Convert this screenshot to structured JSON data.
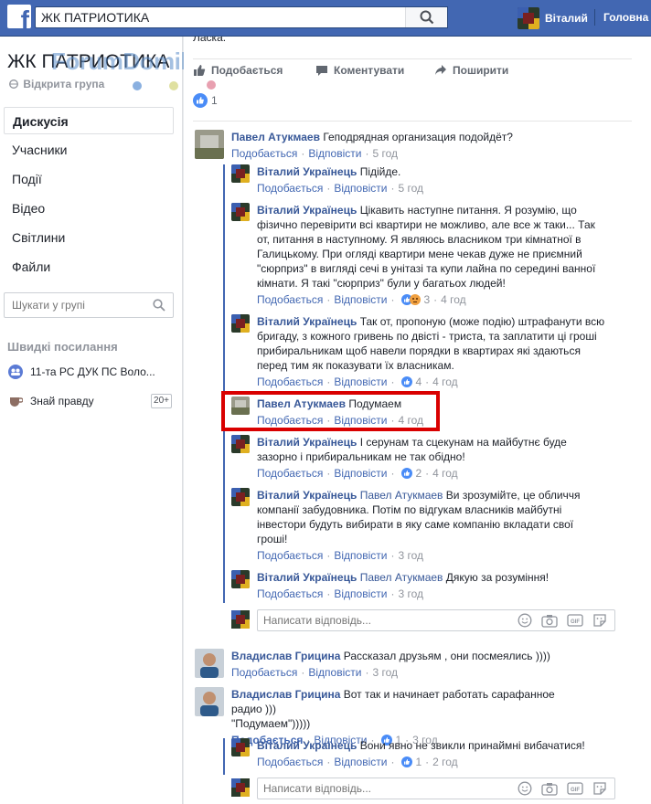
{
  "topbar": {
    "search_value": "ЖК ПАТРИОТИКА",
    "user_name": "Віталий",
    "home": "Головна"
  },
  "left": {
    "group_title": "ЖК ПАТРИОТИКА",
    "watermark": "ForumDomik.ua",
    "privacy": "Відкрита група",
    "nav": [
      "Дискусія",
      "Учасники",
      "Події",
      "Відео",
      "Світлини",
      "Файли"
    ],
    "search_placeholder": "Шукати у групі",
    "quick_title": "Швидкі посилання",
    "quick_links": [
      {
        "label": "11-та РС ДУК ПС Воло...",
        "icon": "group-icon"
      },
      {
        "label": "Знай правду",
        "icon": "cup-icon",
        "badge": "20+"
      }
    ]
  },
  "post": {
    "prev_text": "Ласка.",
    "actions": {
      "like": "Подобається",
      "comment": "Коментувати",
      "share": "Поширити"
    },
    "reaction_count": "1"
  },
  "labels": {
    "like": "Подобається",
    "reply": "Відповісти",
    "reply_placeholder": "Написати відповідь..."
  },
  "comments": [
    {
      "author": "Павел Атукмаев",
      "text": "Геподрядная организация подойдёт?",
      "time": "5 год"
    },
    {
      "author": "Віталий Українець",
      "text": "Підійде.",
      "time": "5 год"
    },
    {
      "author": "Віталий Українець",
      "lines": [
        "Цікавить наступне питання. Я розумію, що",
        "фізично перевірити всі квартири не можливо, але все ж таки... Так",
        "от, питання в наступному. Я являюсь власником три кімнатної в",
        "Галицькому. При огляді квартири мене чекав дуже не приємний",
        "\"сюрприз\" в вигляді сечі в унітазі та купи лайна по середині ванної",
        "кімнати. Я такі \"сюрприз\" були у багатьох людей!"
      ],
      "reactions": "3",
      "time": "4 год"
    },
    {
      "author": "Віталий Українець",
      "lines": [
        "Так от, пропоную (може подію) штрафанути всю",
        "бригаду, з кожного гривень по двісті - триста, та заплатити ці гроші",
        "прибиральникам щоб навели порядки в квартирах які здаються",
        "перед тим як показувати їх власникам."
      ],
      "reactions": "4",
      "time": "4 год"
    },
    {
      "author": "Павел Атукмаев",
      "text": "Подумаем",
      "time": "4 год"
    },
    {
      "author": "Віталий Українець",
      "lines": [
        "І серунам та сцекунам на майбутнє буде",
        "зазорно і прибиральникам не так обідно!"
      ],
      "reactions": "2",
      "time": "4 год"
    },
    {
      "author": "Віталий Українець",
      "mention": "Павел Атукмаев",
      "lines": [
        "Ви зрозумійте, це обличчя",
        "компанії забудовника. Потім по відгукам власників майбутні",
        "інвестори будуть вибирати в яку саме компанію вкладати свої",
        "гроші!"
      ],
      "time": "3 год"
    },
    {
      "author": "Віталий Українець",
      "mention": "Павел Атукмаев",
      "text": "Дякую за розуміння!",
      "time": "3 год"
    },
    {
      "author": "Владислав Грицина",
      "text": "Рассказал друзьям , они посмеялись ))))",
      "time": "3 год"
    },
    {
      "author": "Владислав Грицина",
      "lines": [
        "Вот так и начинает работать сарафанное радио )))",
        "\"Подумаем\")))))"
      ],
      "reactions": "1",
      "time": "3 год"
    },
    {
      "author": "Віталий Українець",
      "text": "Вони явно не звикли принаймні вибачатися!",
      "reactions": "1",
      "time": "2 год"
    }
  ]
}
